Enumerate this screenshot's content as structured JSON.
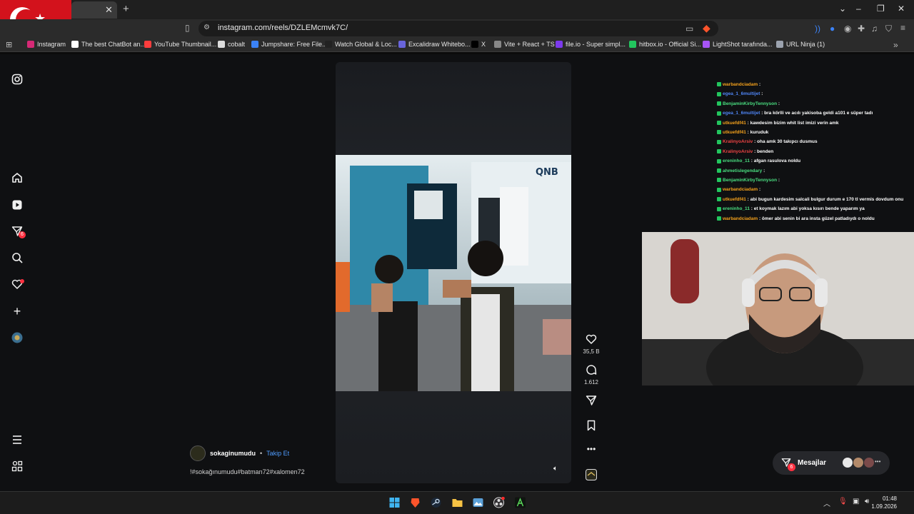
{
  "browser": {
    "url": "instagram.com/reels/DZLEMcmvk7C/",
    "tab_close": "✕",
    "new_tab": "+",
    "bookmarks": [
      {
        "label": "Instagram",
        "color": "#d62976"
      },
      {
        "label": "The best ChatBot an...",
        "color": "#ffffff"
      },
      {
        "label": "YouTube Thumbnail...",
        "color": "#ff3d3d"
      },
      {
        "label": "cobalt",
        "color": "#dddddd"
      },
      {
        "label": "Jumpshare: Free File...",
        "color": "#3b82f6"
      },
      {
        "label": "Watch Global & Loc...",
        "color": "#222222"
      },
      {
        "label": "Excalidraw Whitebo...",
        "color": "#6965db"
      },
      {
        "label": "X",
        "color": "#000000"
      },
      {
        "label": "Vite + React + TS",
        "color": "#888888"
      },
      {
        "label": "file.io - Super simpl...",
        "color": "#7c3aed"
      },
      {
        "label": "hitbox.io - Official Si...",
        "color": "#22c55e"
      },
      {
        "label": "LightShot tarafında...",
        "color": "#a855f7"
      },
      {
        "label": "URL Ninja (1)",
        "color": "#9ca3af"
      }
    ]
  },
  "sidebar": {
    "notification_count": "6"
  },
  "reel": {
    "likes": "35,5 B",
    "comments": "1.612",
    "author": "sokaginumudu",
    "follow": "Takip Et",
    "separator": "•",
    "caption": "!#sokağınumudu#batman72#xalomen72"
  },
  "chat": [
    {
      "user": "warbandciadam",
      "msg": " : ",
      "color": "#f4a11c"
    },
    {
      "user": "egea_1_6multijet",
      "msg": " : ",
      "color": "#4f86f7"
    },
    {
      "user": "BenjaminKirbyTennyson",
      "msg": " : ",
      "color": "#4ade80"
    },
    {
      "user": "egea_1_6multijet",
      "msg": " : bra körlli ve acılı yakisoba geldi a101 e süper tadı",
      "color": "#4f86f7"
    },
    {
      "user": "utkuefdf41",
      "msg": " : kawdesim bizim whit list imizi verin amk",
      "color": "#f4a11c"
    },
    {
      "user": "utkuefdf41",
      "msg": " : kuruduk",
      "color": "#f4a11c"
    },
    {
      "user": "KralinyoArsiv",
      "msg": " : oha amk 30 takıpcı dusmus",
      "color": "#ef4444"
    },
    {
      "user": "KralinyoArsiv",
      "msg": " : benden",
      "color": "#ef4444"
    },
    {
      "user": "ereninho_11",
      "msg": " : afgan rasulova noldu",
      "color": "#4ade80"
    },
    {
      "user": "ahmetislegendary",
      "msg": " : ",
      "color": "#4ade80"
    },
    {
      "user": "BenjaminKirbyTennyson",
      "msg": " : ",
      "color": "#4ade80"
    },
    {
      "user": "warbandciadam",
      "msg": " : ",
      "color": "#f4a11c"
    },
    {
      "user": "utkuefdf41",
      "msg": " : abi bugun kardesim salcali bulgur durum e 170 tl vermis dovdum onu",
      "color": "#f4a11c"
    },
    {
      "user": "ereninho_11",
      "msg": " : et koymak lazım abi yoksa kısırı bende yaparım ya",
      "color": "#4ade80"
    },
    {
      "user": "warbandciadam",
      "msg": " : ömer abi senin bi ara insta güzel patladıydı o noldu",
      "color": "#f4a11c"
    }
  ],
  "messages_label": "Mesajlar",
  "messages_count": "6",
  "clock": {
    "time": "01:48",
    "date": "1.09.2026"
  }
}
